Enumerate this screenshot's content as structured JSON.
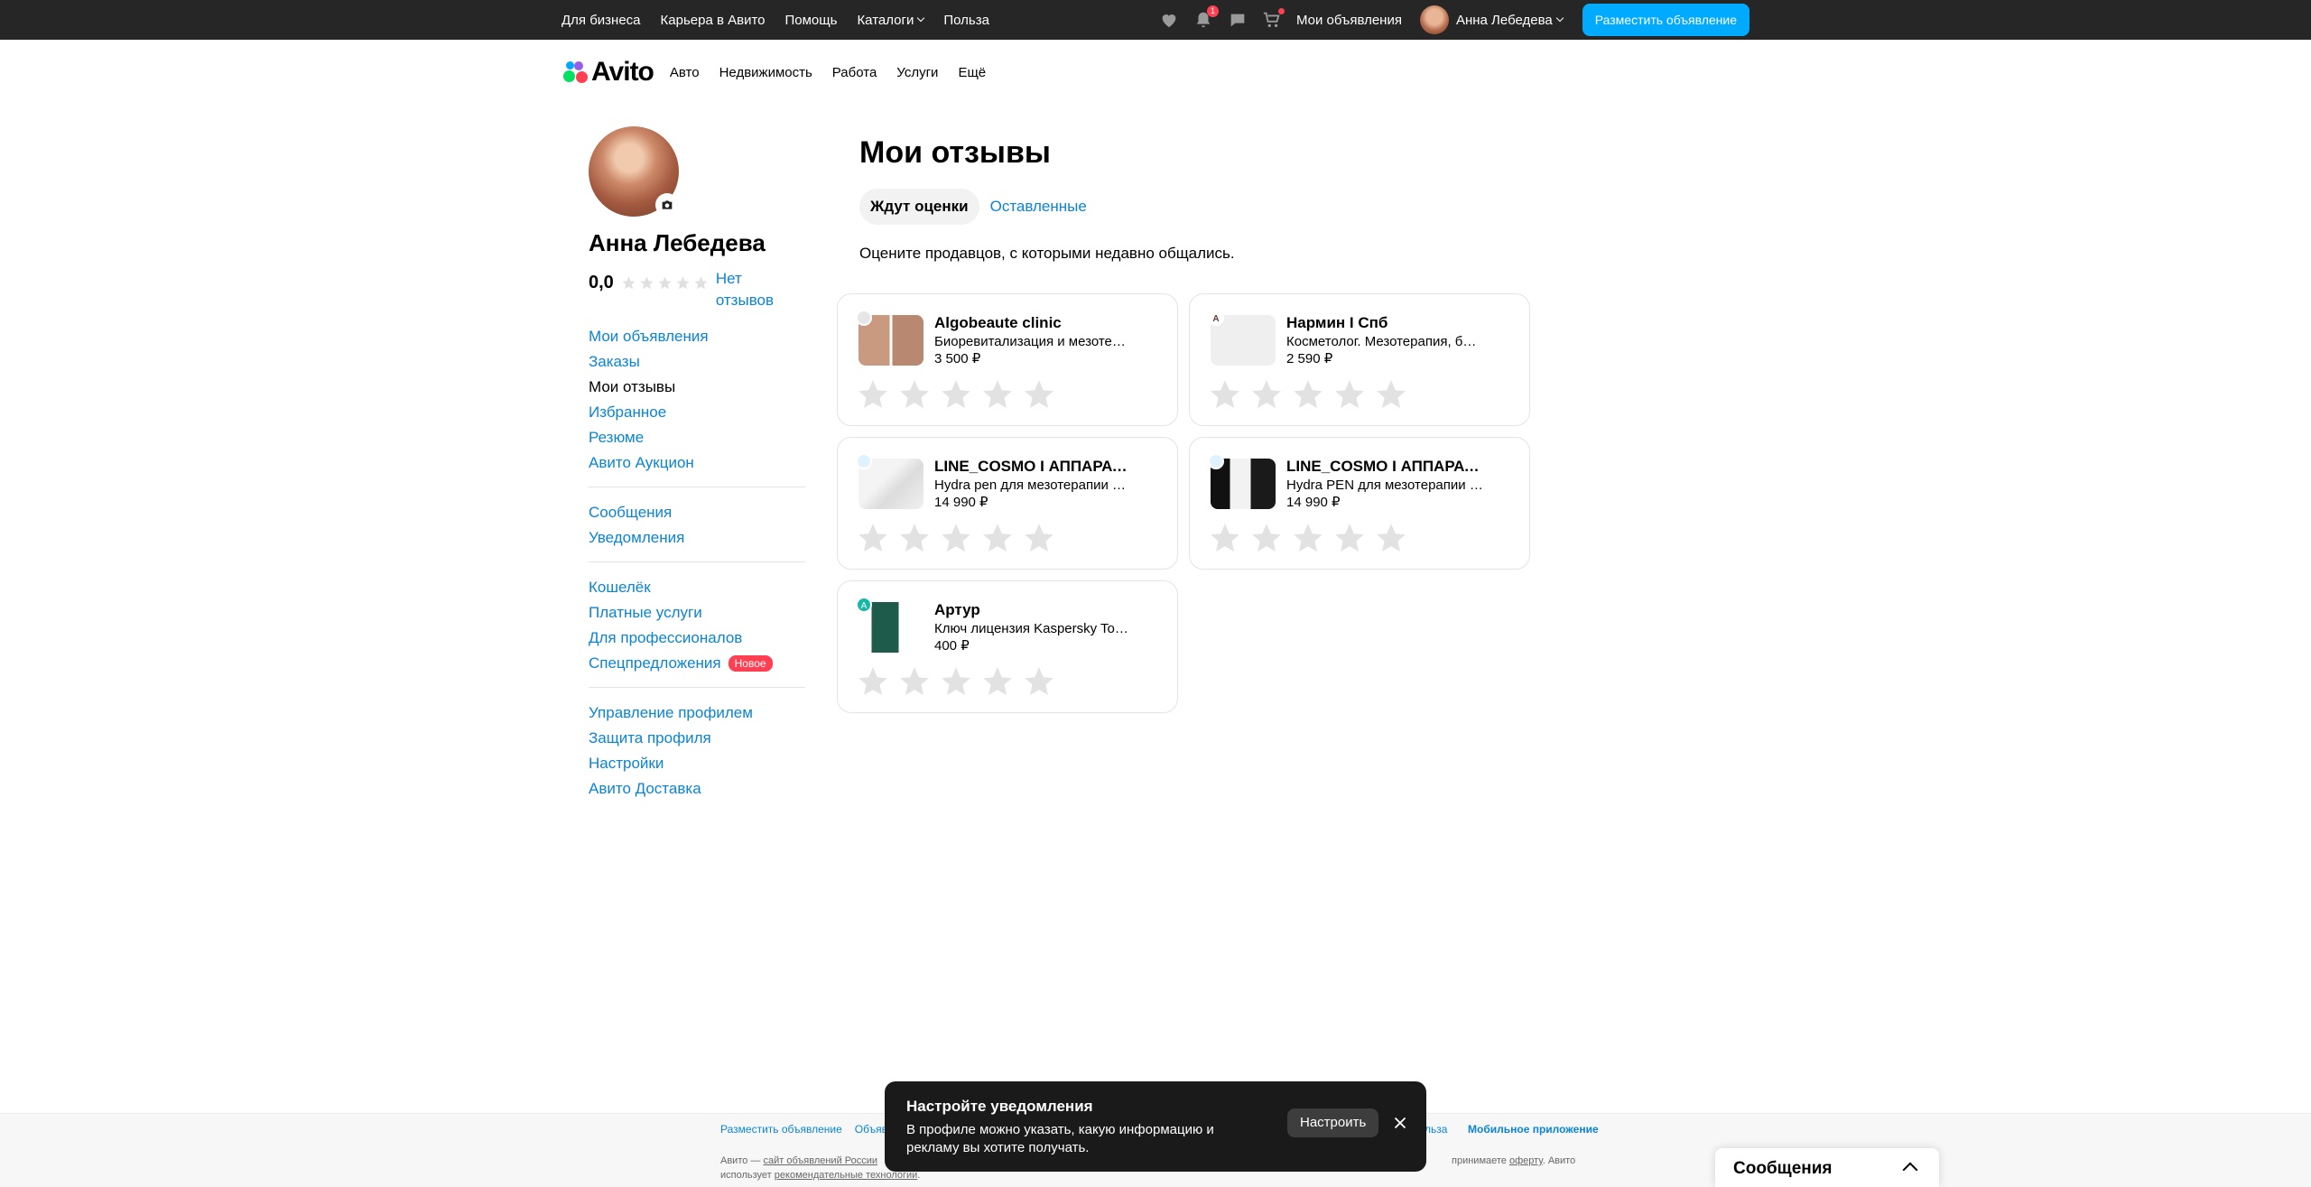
{
  "topbar": {
    "links": [
      "Для бизнеса",
      "Карьера в Авито",
      "Помощь",
      "Каталоги",
      "Польза"
    ],
    "notification_count": "1",
    "my_ads": "Мои объявления",
    "user_name": "Анна Лебедева",
    "post_button": "Разместить объявление"
  },
  "nav": {
    "logo": "Avito",
    "categories": [
      "Авто",
      "Недвижимость",
      "Работа",
      "Услуги",
      "Ещё"
    ]
  },
  "profile": {
    "name": "Анна Лебедева",
    "rating": "0,0",
    "no_reviews": "Нет отзывов"
  },
  "sidebar": {
    "group1": [
      "Мои объявления",
      "Заказы",
      "Мои отзывы",
      "Избранное",
      "Резюме",
      "Авито Аукцион"
    ],
    "group2": [
      "Сообщения",
      "Уведомления"
    ],
    "group3": [
      "Кошелёк",
      "Платные услуги",
      "Для профессионалов",
      "Спецпредложения"
    ],
    "new_badge": "Новое",
    "group4": [
      "Управление профилем",
      "Защита профиля",
      "Настройки",
      "Авито Доставка"
    ]
  },
  "main": {
    "title": "Мои отзывы",
    "tabs": [
      "Ждут оценки",
      "Оставленные"
    ],
    "intro": "Оцените продавцов, с которыми недавно общались."
  },
  "cards": [
    {
      "title": "Algobeaute clinic",
      "desc": "Биоревитализация и мезотерапия",
      "price": "3 500 ₽",
      "avatar": ""
    },
    {
      "title": "Нармин I Спб",
      "desc": "Косметолог. Мезотерапия, биоревитализация",
      "price": "2 590 ₽",
      "avatar": "A"
    },
    {
      "title": "LINE_COSMO I АППАРАТЫ ДЛЯ КОСМЕТОЛОГИИ",
      "desc": "Hydra pen для мезотерапии И биоревитализации",
      "price": "14 990 ₽",
      "avatar": ""
    },
    {
      "title": "LINE_COSMO I АППАРАТЫ ДЛЯ КОСМЕТОЛОГИИ",
      "desc": "Hydra PEN для мезотерапии и биоревитализации",
      "price": "14 990 ₽",
      "avatar": ""
    },
    {
      "title": "Артур",
      "desc": "Ключ лицензия Kaspersky Total Security",
      "price": "400 ₽",
      "avatar": "А"
    }
  ],
  "footer": {
    "links": [
      "Разместить объявление",
      "Объяв"
    ],
    "policy_tail": "льза",
    "app_link": "Мобильное приложение",
    "legal_1a": "Авито — ",
    "legal_1b": "сайт объявлений России",
    "legal_1c": "принимаете ",
    "legal_1d": "оферту",
    "legal_1e": ". Авито",
    "legal_2a": "использует ",
    "legal_2b": "рекомендательные технологии",
    "legal_2c": "."
  },
  "toast": {
    "title": "Настройте уведомления",
    "body": "В профиле можно указать, какую информацию и рекламу вы хотите получать.",
    "button": "Настроить"
  },
  "messenger": {
    "label": "Сообщения"
  },
  "colors": {
    "accent": "#00aaff",
    "link": "#0a84d6",
    "badge": "#ff4053",
    "topbar": "#262626"
  }
}
